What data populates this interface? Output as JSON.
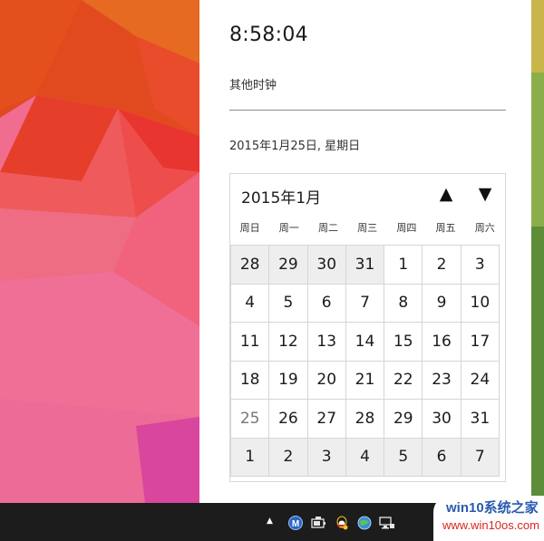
{
  "clock": {
    "time": "8:58:04",
    "other_clocks_label": "其他时钟",
    "full_date": "2015年1月25日, 星期日"
  },
  "calendar": {
    "month_title": "2015年1月",
    "prev_icon": "▲",
    "next_icon": "▼",
    "weekdays": [
      "周日",
      "周一",
      "周二",
      "周三",
      "周四",
      "周五",
      "周六"
    ],
    "weeks": [
      [
        "28",
        "29",
        "30",
        "31",
        "1",
        "2",
        "3"
      ],
      [
        "4",
        "5",
        "6",
        "7",
        "8",
        "9",
        "10"
      ],
      [
        "11",
        "12",
        "13",
        "14",
        "15",
        "16",
        "17"
      ],
      [
        "18",
        "19",
        "20",
        "21",
        "22",
        "23",
        "24"
      ],
      [
        "25",
        "26",
        "27",
        "28",
        "29",
        "30",
        "31"
      ],
      [
        "1",
        "2",
        "3",
        "4",
        "5",
        "6",
        "7"
      ]
    ],
    "today": "25"
  },
  "taskbar": {
    "show_hidden_icon": "▲",
    "tray_icons": [
      "m-app-icon",
      "battery-icon",
      "qq-icon",
      "network-globe-icon",
      "network-computer-icon"
    ]
  },
  "watermark": {
    "title": "win10系统之家",
    "url": "www.win10os.com"
  },
  "colors": {
    "wallpaper_orange": "#e8531f",
    "wallpaper_pink": "#f06a8f",
    "taskbar": "#1c1c1c",
    "other_month_cell": "#eeeeee"
  }
}
